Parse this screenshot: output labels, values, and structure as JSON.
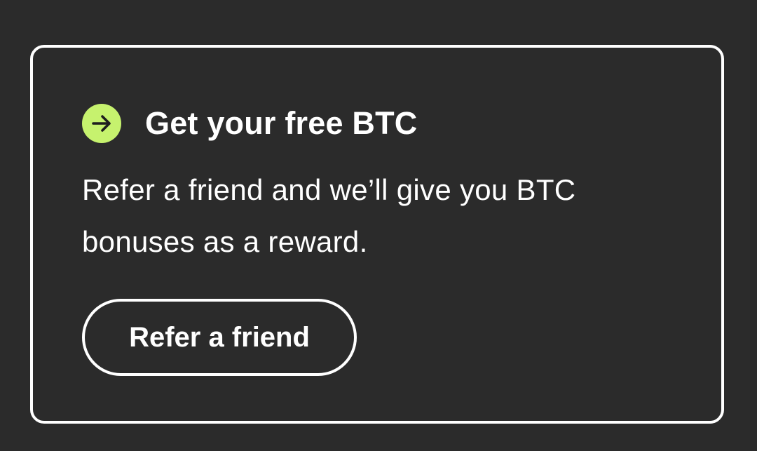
{
  "card": {
    "title": "Get your free BTC",
    "description": "Refer a friend and we’ll give you BTC bonuses as a reward.",
    "button_label": "Refer a friend",
    "icon": "arrow-right-circle-icon",
    "accent_color": "#c6f26e",
    "background_color": "#2b2b2b",
    "text_color": "#ffffff"
  }
}
